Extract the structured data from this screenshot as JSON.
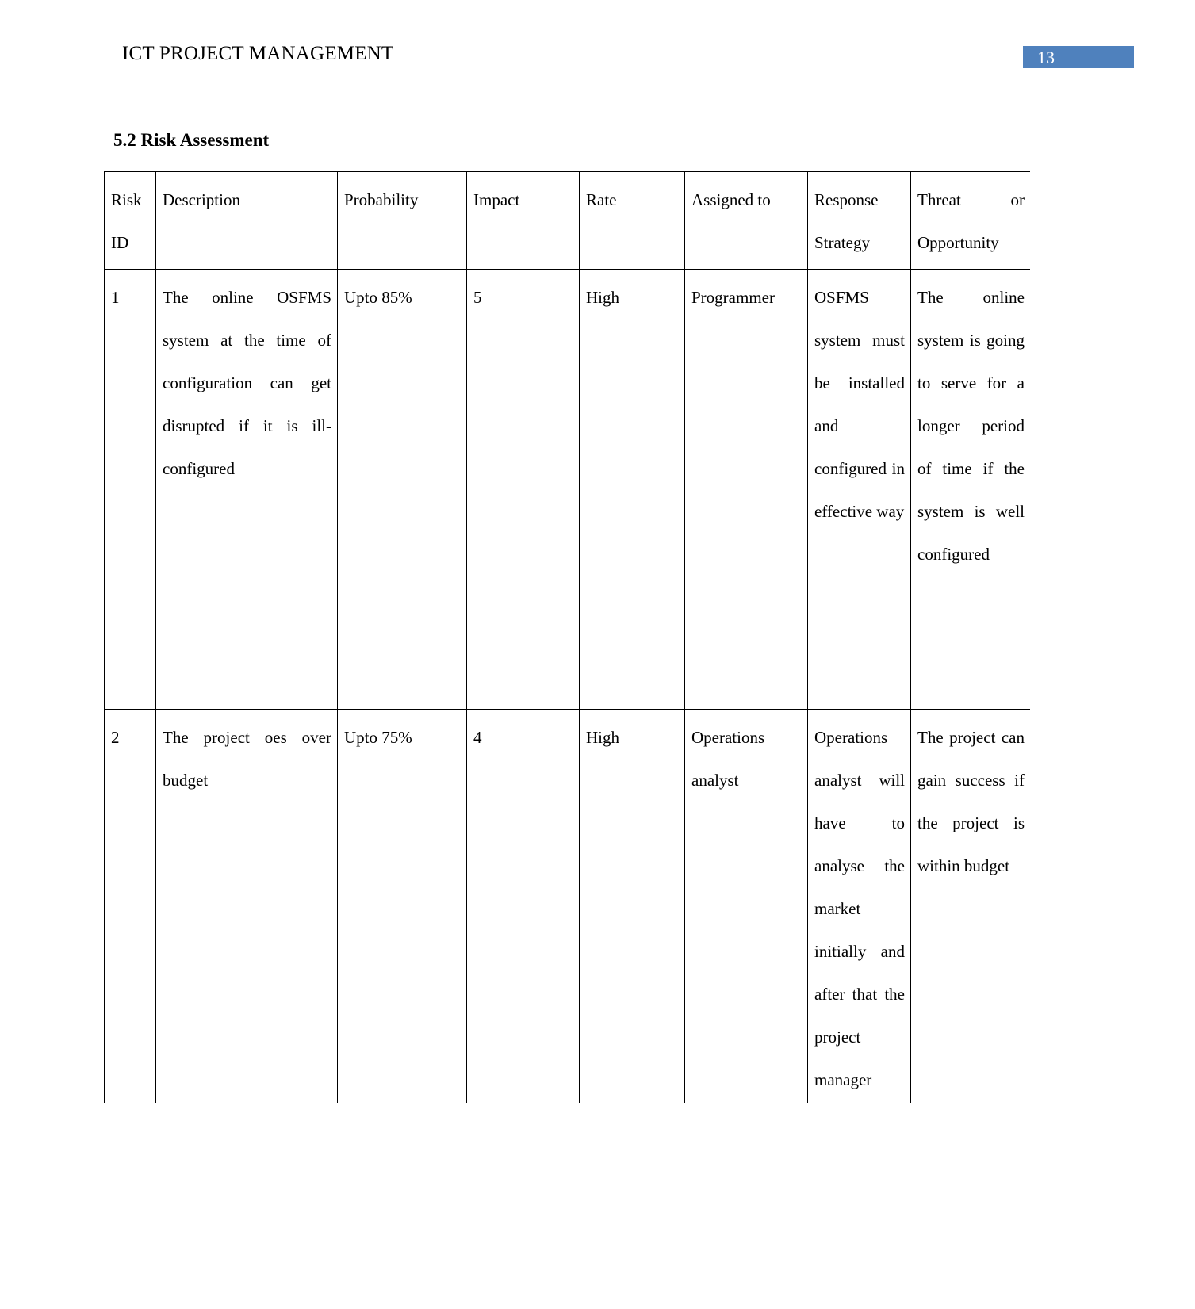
{
  "header": {
    "document_title": "ICT PROJECT MANAGEMENT",
    "page_number": "13",
    "banner_color": "#4f81bd"
  },
  "section": {
    "heading": "5.2 Risk Assessment"
  },
  "table": {
    "columns": [
      "Risk ID",
      "Description",
      "Probability",
      "Impact",
      "Rate",
      "Assigned to",
      "Response Strategy",
      "Threat or Opportunity"
    ],
    "rows": [
      {
        "risk_id": "1",
        "description": "The online OSFMS system at the time of configuration can get disrupted if it is ill-configured",
        "probability": "Upto 85%",
        "impact": "5",
        "rate": "High",
        "assigned_to": "Programmer",
        "response_strategy": "OSFMS system must be installed and configured in effective way",
        "threat_or_opportunity": "The online system is going to serve for a longer period of time if the system is well configured"
      },
      {
        "risk_id": "2",
        "description": "The project oes over budget",
        "probability": "Upto 75%",
        "impact": "4",
        "rate": "High",
        "assigned_to": "Operations analyst",
        "response_strategy": "Operations analyst will have to analyse the market initially and after that the project manager",
        "threat_or_opportunity": "The project can gain success if the project is within budget"
      }
    ]
  }
}
